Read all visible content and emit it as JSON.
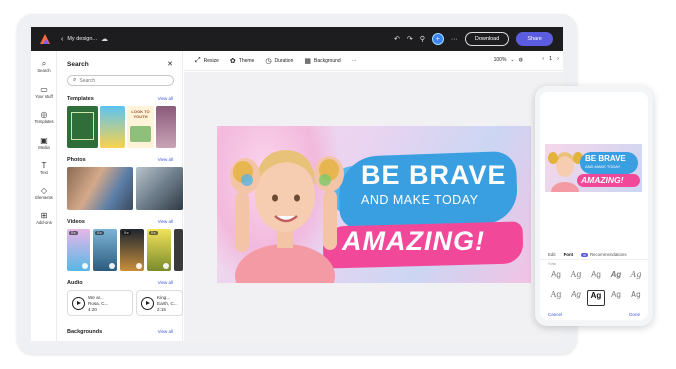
{
  "app": {
    "doc_name": "My design...",
    "download_label": "Download",
    "share_label": "Share"
  },
  "rail": {
    "items": [
      {
        "label": "Search",
        "icon": "search-icon"
      },
      {
        "label": "Your stuff",
        "icon": "folder-icon"
      },
      {
        "label": "Templates",
        "icon": "templates-icon"
      },
      {
        "label": "Media",
        "icon": "media-icon"
      },
      {
        "label": "Text",
        "icon": "text-icon"
      },
      {
        "label": "Elements",
        "icon": "elements-icon"
      },
      {
        "label": "Add-ons",
        "icon": "add-ons-icon"
      }
    ]
  },
  "panel": {
    "title": "Search",
    "search_placeholder": "Search",
    "sections": {
      "templates": "Templates",
      "photos": "Photos",
      "videos": "Videos",
      "audio": "Audio",
      "backgrounds": "Backgrounds"
    },
    "view_all": "View all",
    "video_durations": [
      "0:x",
      "0:x",
      "0:x",
      "0:x"
    ],
    "audio": [
      {
        "title": "We ar...",
        "artist": "Rosa, C...",
        "duration": "4:20"
      },
      {
        "title": "King...",
        "artist": "Earth, C...",
        "duration": "2:15"
      }
    ],
    "template_texts": [
      "LOOK TO YOUTH"
    ]
  },
  "toolbar": {
    "resize": "Resize",
    "theme": "Theme",
    "duration": "Duration",
    "background": "Background",
    "more": "···",
    "zoom": "100%",
    "page": "1"
  },
  "design": {
    "line1": "BE BRAVE",
    "line2": "AND MAKE TODAY",
    "line3": "AMAZING!"
  },
  "phone": {
    "tabs": [
      "Edit",
      "Font",
      "Recommendations"
    ],
    "active_tab": "Font",
    "ai_badge": "AI",
    "caption": "Fonts",
    "font_sample": "Ag",
    "cancel": "Cancel",
    "done": "Done"
  },
  "colors": {
    "topbar": "#1d1d20",
    "accent": "#5c5ce0",
    "link": "#3d5ad8",
    "brush_blue": "#3a9fe0",
    "brush_pink": "#f2489a"
  }
}
